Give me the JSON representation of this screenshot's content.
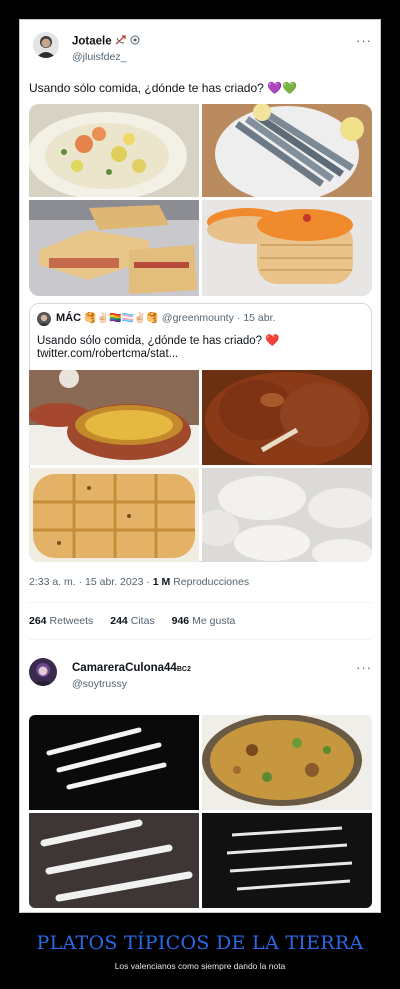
{
  "tweet": {
    "author_name": "Jotaele",
    "author_handle": "@jluisfdez_",
    "more": "···",
    "text": "Usando sólo comida, ¿dónde te has criado?",
    "text_emoji": "💜💚",
    "quote": {
      "author_name": "MÁC",
      "author_emojis": "🥞✌🏻🏳️‍🌈🏳️‍⚧️✌🏻🥞",
      "author_handle": "@greenmounty",
      "date": "· 15 abr.",
      "text": "Usando sólo comida, ¿dónde te has criado?",
      "text_emoji": "❤️",
      "link": "twitter.com/robertcma/stat..."
    },
    "timestamp": "2:33 a. m. · 15 abr. 2023 ·",
    "views_count": "1 M",
    "views_label": "Reproducciones",
    "stats": [
      {
        "count": "264",
        "label": "Retweets"
      },
      {
        "count": "244",
        "label": "Citas"
      },
      {
        "count": "946",
        "label": "Me gusta"
      }
    ]
  },
  "reply": {
    "author_name": "CamareraCulona44",
    "author_suffix": "BC2",
    "author_handle": "@soytrussy",
    "more": "···"
  },
  "caption": {
    "title": "PLATOS TÍPICOS DE LA TIERRA",
    "subtitle": "Los valencianos como siempre dando la nota"
  },
  "colors": {
    "caption_title": "#2a6ae8",
    "heart_red": "#e0245e",
    "background": "#000000"
  }
}
